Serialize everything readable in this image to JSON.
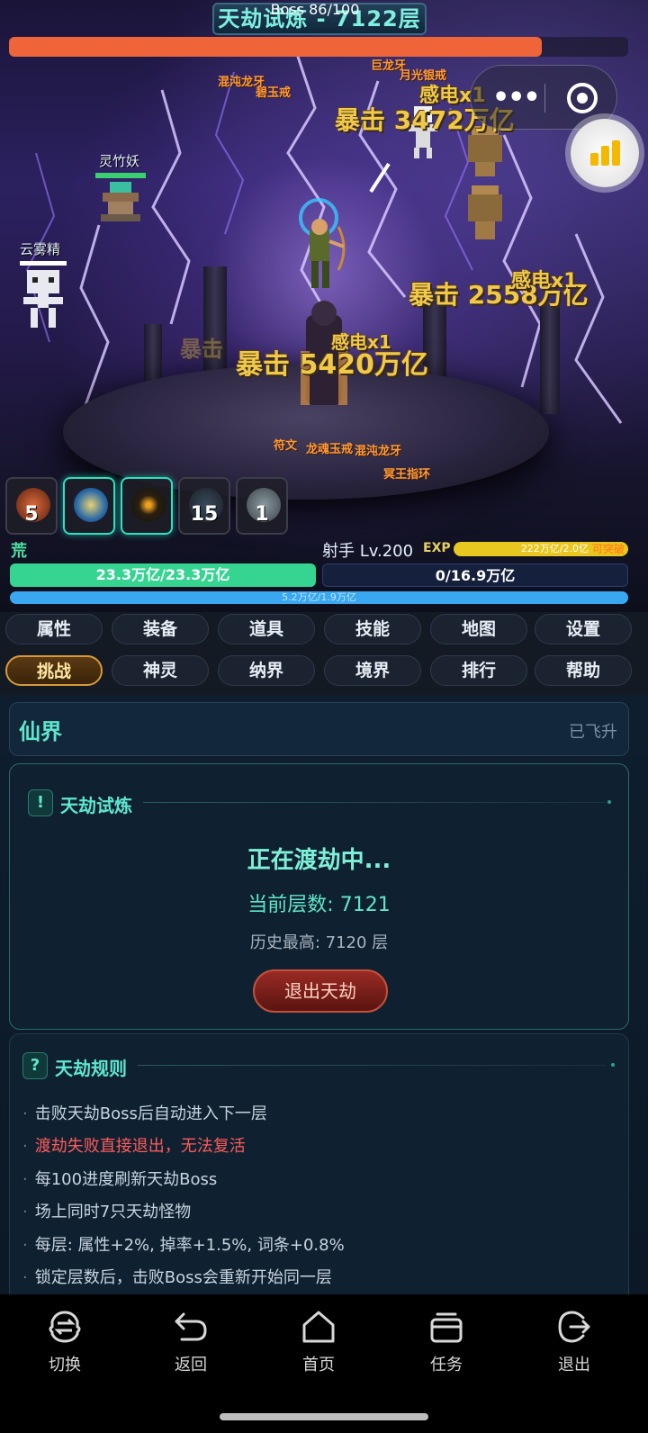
{
  "scene": {
    "title": "天劫试炼 - 7122层",
    "boss_bar": {
      "label": "Boss 86/100",
      "progress": 0.86
    },
    "damage_numbers": [
      "暴击 3472万亿",
      "暴击 2558万亿",
      "暴击 5420万亿"
    ],
    "debuffs": [
      "感电x1",
      "感电x1",
      "感电x1"
    ],
    "faded_text": [
      "暴击"
    ],
    "item_drops": [
      "混沌龙牙",
      "碧玉戒",
      "巨龙牙",
      "月光银戒",
      "符文",
      "龙魂玉戒",
      "混沌龙牙",
      "冥王指环"
    ],
    "monsters": [
      "灵竹妖",
      "云雾精"
    ],
    "skills": [
      {
        "count": "5",
        "active": false,
        "icon": "fire-skill-icon"
      },
      {
        "count": "",
        "active": true,
        "icon": "vortex-skill-icon"
      },
      {
        "count": "",
        "active": true,
        "icon": "dark-orb-skill-icon"
      },
      {
        "count": "15",
        "active": false,
        "icon": "shadow-skill-icon"
      },
      {
        "count": "1",
        "active": false,
        "icon": "wind-skill-icon"
      }
    ]
  },
  "player": {
    "realm": "荒",
    "class_level": "射手 Lv.200",
    "exp_label": "EXP",
    "exp_text": "222万亿/2.0亿",
    "exp_tag": "可突破",
    "exp_progress": 1.0,
    "hp": {
      "text": "23.3万亿/23.3万亿",
      "progress": 1.0
    },
    "mp": {
      "text": "0/16.9万亿",
      "progress": 0.0
    },
    "shield": {
      "text": "5.2万亿/1.9万亿",
      "progress": 1.0
    }
  },
  "tabs": {
    "row1": [
      "属性",
      "装备",
      "道具",
      "技能",
      "地图",
      "设置"
    ],
    "row2": [
      "挑战",
      "神灵",
      "纳界",
      "境界",
      "排行",
      "帮助"
    ],
    "selected": "挑战"
  },
  "realm_panel": {
    "title": "仙界",
    "status": "已飞升"
  },
  "trial_card": {
    "icon": "!",
    "title": "天劫试炼",
    "state": "正在渡劫中...",
    "current_floor": "当前层数: 7121",
    "best_floor": "历史最高: 7120 层",
    "exit_button": "退出天劫"
  },
  "rules_card": {
    "icon": "?",
    "title": "天劫规则",
    "bullet": "·",
    "items": [
      "击败天劫Boss后自动进入下一层",
      "渡劫失败直接退出，无法复活",
      "每100进度刷新天劫Boss",
      "场上同时7只天劫怪物",
      "每层: 属性+2%, 掉率+1.5%, 词条+0.8%",
      "锁定层数后，击败Boss会重新开始同一层"
    ]
  },
  "bottom_nav": [
    {
      "label": "切换",
      "icon": "switch-icon"
    },
    {
      "label": "返回",
      "icon": "back-icon"
    },
    {
      "label": "首页",
      "icon": "home-icon"
    },
    {
      "label": "任务",
      "icon": "tasks-icon"
    },
    {
      "label": "退出",
      "icon": "exit-icon"
    }
  ],
  "colors": {
    "accent": "#5fe6d0",
    "hp": "#35d491",
    "boss": "#f0643a",
    "warning": "#ff5a5a",
    "damage": "#f0c84a"
  }
}
